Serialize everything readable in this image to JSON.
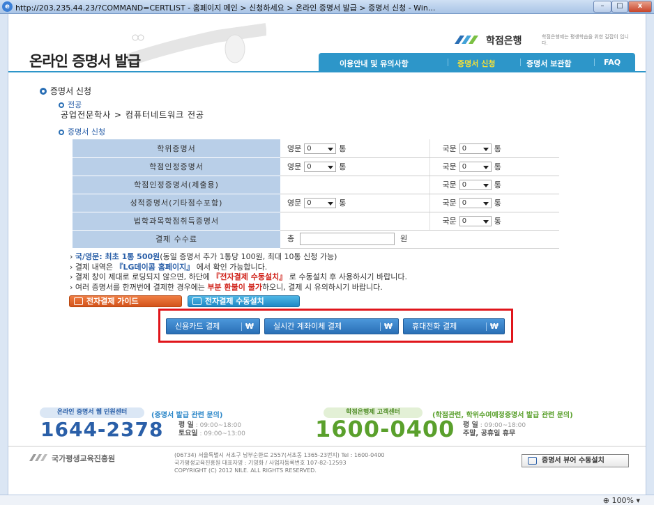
{
  "window": {
    "url_title": "http://203.235.44.23/?COMMAND=CERTLIST - 홈페이지 메인 > 신청하세요 > 온라인 증명서 발급 > 증명서 신청 - Win..."
  },
  "header": {
    "title": "온라인 증명서 발급",
    "logo_name": "학점은행",
    "logo_sub": "학점은행제는 평생학습을 위한 길잡이 입니다."
  },
  "nav": {
    "items": [
      "이용안내 및 유의사항",
      "증명서 신청",
      "증명서 보관함",
      "FAQ"
    ],
    "active": "증명서 신청"
  },
  "section": {
    "title": "증명서 신청",
    "major_label": "전공",
    "major_path": "공업전문학사 > 컴퓨터네트워크 전공",
    "apply_label": "증명서 신청"
  },
  "table": {
    "eng_label": "영문",
    "kor_label": "국문",
    "unit": "통",
    "rows": [
      {
        "name": "학위증명서",
        "eng": "0",
        "kor": "0"
      },
      {
        "name": "학점인정증명서",
        "eng": "0",
        "kor": "0"
      },
      {
        "name": "학점인정증명서(제출용)",
        "eng": "",
        "kor": "0"
      },
      {
        "name": "성적증명서(기타점수포함)",
        "eng": "0",
        "kor": "0"
      },
      {
        "name": "법학과목학점취득증명서",
        "eng": "",
        "kor": "0"
      }
    ],
    "fee_label": "결제 수수료",
    "fee_prefix": "총",
    "fee_suffix": "원"
  },
  "notes": {
    "n1_hl": "국/영문: 최초 1통 500원",
    "n1_rest": "(동일 증명서 추가 1통당 100원, 최대 10통 신청 가능)",
    "n2_pre": "결제 내역은 ",
    "n2_hl": "『LG데이콤 홈페이지』",
    "n2_post": " 에서 확인 가능합니다.",
    "n3_pre": "결제 창이 제대로 로딩되지 않으면, 하단에 ",
    "n3_hl": "『전자결제 수동설치』",
    "n3_post": " 로 수동설치 후 사용하시기 바랍니다.",
    "n4_pre": "여러 증명서를 한꺼번에 결제한 경우에는 ",
    "n4_hl": "부분 환불이 불가",
    "n4_post": "하오니, 결제 시 유의하시기 바랍니다."
  },
  "buttons": {
    "guide": "전자결제 가이드",
    "install": "전자결제 수동설치",
    "pay_card": "신용카드 결제",
    "pay_transfer": "실시간 계좌이체 결제",
    "pay_phone": "휴대전화 결제",
    "won": "₩",
    "viewer": "증명서 뷰어 수동설치"
  },
  "support": {
    "left_badge": "온라인 증명서 웹 민원센터",
    "left_note": "(증명서 발급 관련 문의)",
    "left_phone": "1644-2378",
    "right_badge": "학점은행제 고객센터",
    "right_note": "(학점관련, 학위수여예정증명서 발급 관련 문의)",
    "right_phone": "1600-0400",
    "weekday_label": "평 일",
    "weekday_hours": ": 09:00~18:00",
    "saturday_label": "토요일",
    "saturday_hours": ": 09:00~13:00",
    "holiday_text": "주말, 공휴일 휴무"
  },
  "footer": {
    "org": "국가평생교육진흥원",
    "addr1": "(06734) 서울특별시 서초구 남부순환로 2557(서초동 1365-23번지)   Tel : 1600-0400",
    "addr2": "국가평생교육진흥원 대표자명 : 기영화 / 사업자등록번호 107-82-12593",
    "addr3": "COPYRIGHT (C) 2012 NILE. ALL RIGHTS RESERVED."
  },
  "status": {
    "zoom": "100%"
  },
  "colors": {
    "nav_bg": "#2d96c9",
    "highlight_border": "#e0151b",
    "left_phone": "#2a5fa8",
    "right_phone": "#5aa02c"
  }
}
